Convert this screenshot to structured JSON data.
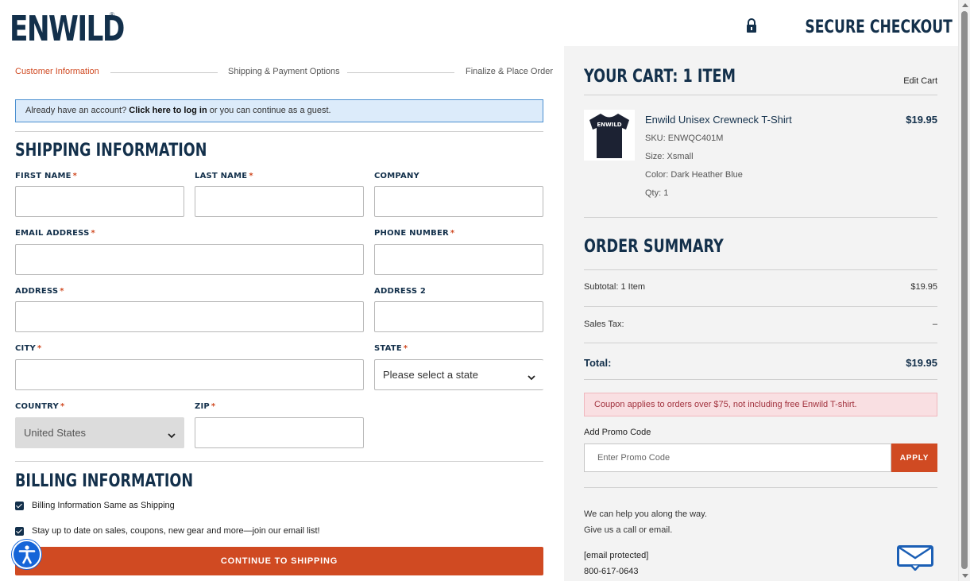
{
  "header": {
    "logo": "ENWILD",
    "logo_mark": "®",
    "secure_checkout": "SECURE CHECKOUT"
  },
  "steps": [
    "Customer Information",
    "Shipping & Payment Options",
    "Finalize & Place Order"
  ],
  "notice": {
    "prefix": "Already have an account? ",
    "link": "Click here to log in",
    "suffix": " or you can continue as a guest."
  },
  "shipping": {
    "title": "SHIPPING INFORMATION",
    "fields": {
      "first_name": "FIRST NAME",
      "last_name": "LAST NAME",
      "company": "COMPANY",
      "email": "EMAIL ADDRESS",
      "phone": "PHONE NUMBER",
      "address": "ADDRESS",
      "address2": "ADDRESS 2",
      "city": "CITY",
      "state": "STATE",
      "country": "COUNTRY",
      "zip": "ZIP"
    },
    "required_mark": "*",
    "state_value": "Please select a state",
    "country_value": "United States"
  },
  "billing": {
    "title": "BILLING INFORMATION",
    "same_as_shipping": "Billing Information Same as Shipping",
    "newsletter": "Stay up to date on sales, coupons, new gear and more—join our email list!"
  },
  "continue_button": "CONTINUE TO SHIPPING",
  "cart": {
    "title": "YOUR CART: 1 ITEM",
    "edit": "Edit Cart",
    "item": {
      "thumb_text": "ENWILD",
      "name": "Enwild Unisex Crewneck T-Shirt",
      "price": "$19.95",
      "sku": "SKU: ENWQC401M",
      "size": "Size: Xsmall",
      "color": "Color: Dark Heather Blue",
      "qty": "Qty: 1"
    }
  },
  "summary": {
    "title": "ORDER SUMMARY",
    "subtotal_label": "Subtotal: 1 Item",
    "subtotal_value": "$19.95",
    "tax_label": "Sales Tax:",
    "tax_value": "–",
    "total_label": "Total:",
    "total_value": "$19.95"
  },
  "coupon_notice": "Coupon applies to orders over $75, not including free Enwild T-shirt.",
  "promo": {
    "label": "Add Promo Code",
    "placeholder": "Enter Promo Code",
    "apply": "APPLY"
  },
  "help": {
    "line1": "We can help you along the way.",
    "line2": "Give us a call or email.",
    "email": "[email protected]",
    "phone": "800-617-0643"
  },
  "colors": {
    "brand_navy": "#13304b",
    "accent_orange": "#d04a22",
    "notice_blue": "#dcebfa",
    "coupon_pink": "#f9dfe2"
  }
}
